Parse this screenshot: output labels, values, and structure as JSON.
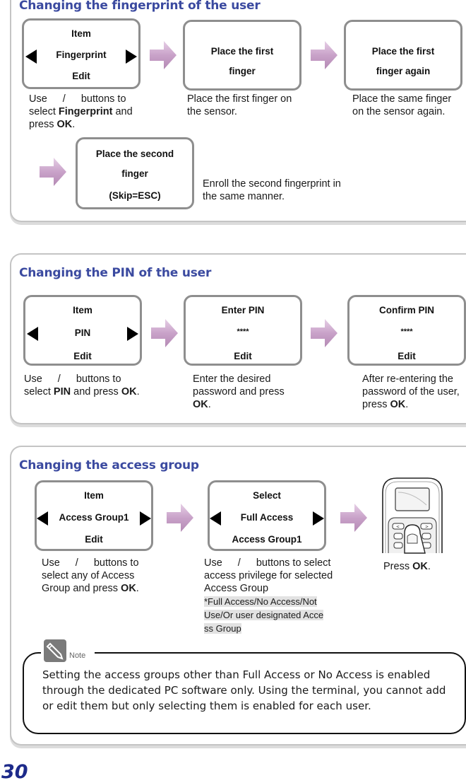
{
  "sections": {
    "fingerprint": {
      "title": "Changing the fingerprint of the user",
      "screen1": {
        "top": "Item",
        "middle": "Fingerprint",
        "bottom": "Edit"
      },
      "screen2": {
        "line1": "Place the first",
        "line2": "finger"
      },
      "screen3": {
        "line1": "Place the first",
        "line2": "finger again"
      },
      "screen4": {
        "line1": "Place the second",
        "line2": "finger",
        "line3": "(Skip=ESC)"
      },
      "desc1": {
        "use": "Use",
        "slash": "/",
        "buttons_to": "buttons to",
        "select": "select",
        "item": "Fingerprint",
        "and": "and",
        "press": "press",
        "ok": "OK",
        "period": "."
      },
      "desc2": "Place the first finger on the sensor.",
      "desc3": "Place the same finger on the sensor again.",
      "desc4": "Enroll the second fingerprint in the same manner."
    },
    "pin": {
      "title": "Changing the PIN of the user",
      "screen1": {
        "top": "Item",
        "middle": "PIN",
        "bottom": "Edit"
      },
      "screen2": {
        "top": "Enter PIN",
        "middle": "****",
        "bottom": "Edit"
      },
      "screen3": {
        "top": "Confirm PIN",
        "middle": "****",
        "bottom": "Edit"
      },
      "desc1": {
        "use": "Use",
        "slash": "/",
        "buttons_to": "buttons to",
        "select": "select",
        "item": "PIN",
        "and_press": "and press",
        "ok": "OK",
        "period": "."
      },
      "desc2": {
        "text": "Enter the desired password and press",
        "ok": "OK",
        "period": "."
      },
      "desc3": {
        "text": "After re-entering the password of the user, press",
        "ok": "OK",
        "period": "."
      }
    },
    "access_group": {
      "title": "Changing the access group",
      "screen1": {
        "top": "Item",
        "middle": "Access Group1",
        "bottom": "Edit"
      },
      "screen2": {
        "top": "Select",
        "middle": "Full Access",
        "bottom": "Access Group1"
      },
      "desc1": {
        "use": "Use",
        "slash": "/",
        "buttons_to": "buttons to",
        "text": "select any of Access Group and press",
        "ok": "OK",
        "period": "."
      },
      "desc2": {
        "use": "Use",
        "slash": "/",
        "text": "buttons to select access privilege for selected Access Group",
        "note_line1": "*Full  Access/No  Access/Not ",
        "note_line2": "Use/Or  user  designated  Acce",
        "note_line3": "ss  Group"
      },
      "desc3": {
        "press": "Press",
        "ok": "OK",
        "period": "."
      }
    }
  },
  "note": {
    "label": "Note",
    "text": "Setting the access groups other than Full Access or No Access is enabled through the dedicated PC software only. Using the terminal, you cannot add or edit them but only selecting them is enabled for each user."
  },
  "page_number": "30",
  "icons": {
    "arrow": "right-arrow-icon",
    "left": "left-triangle-icon",
    "right": "right-triangle-icon",
    "note": "pencil-note-icon",
    "device": "fingerprint-terminal-image"
  },
  "colors": {
    "title": "#3b4aa0",
    "page_number": "#1d2a8a",
    "arrow": "#c8a0c8",
    "panel_border": "#c4c4c4",
    "lcd_border": "#8e8e8e"
  }
}
